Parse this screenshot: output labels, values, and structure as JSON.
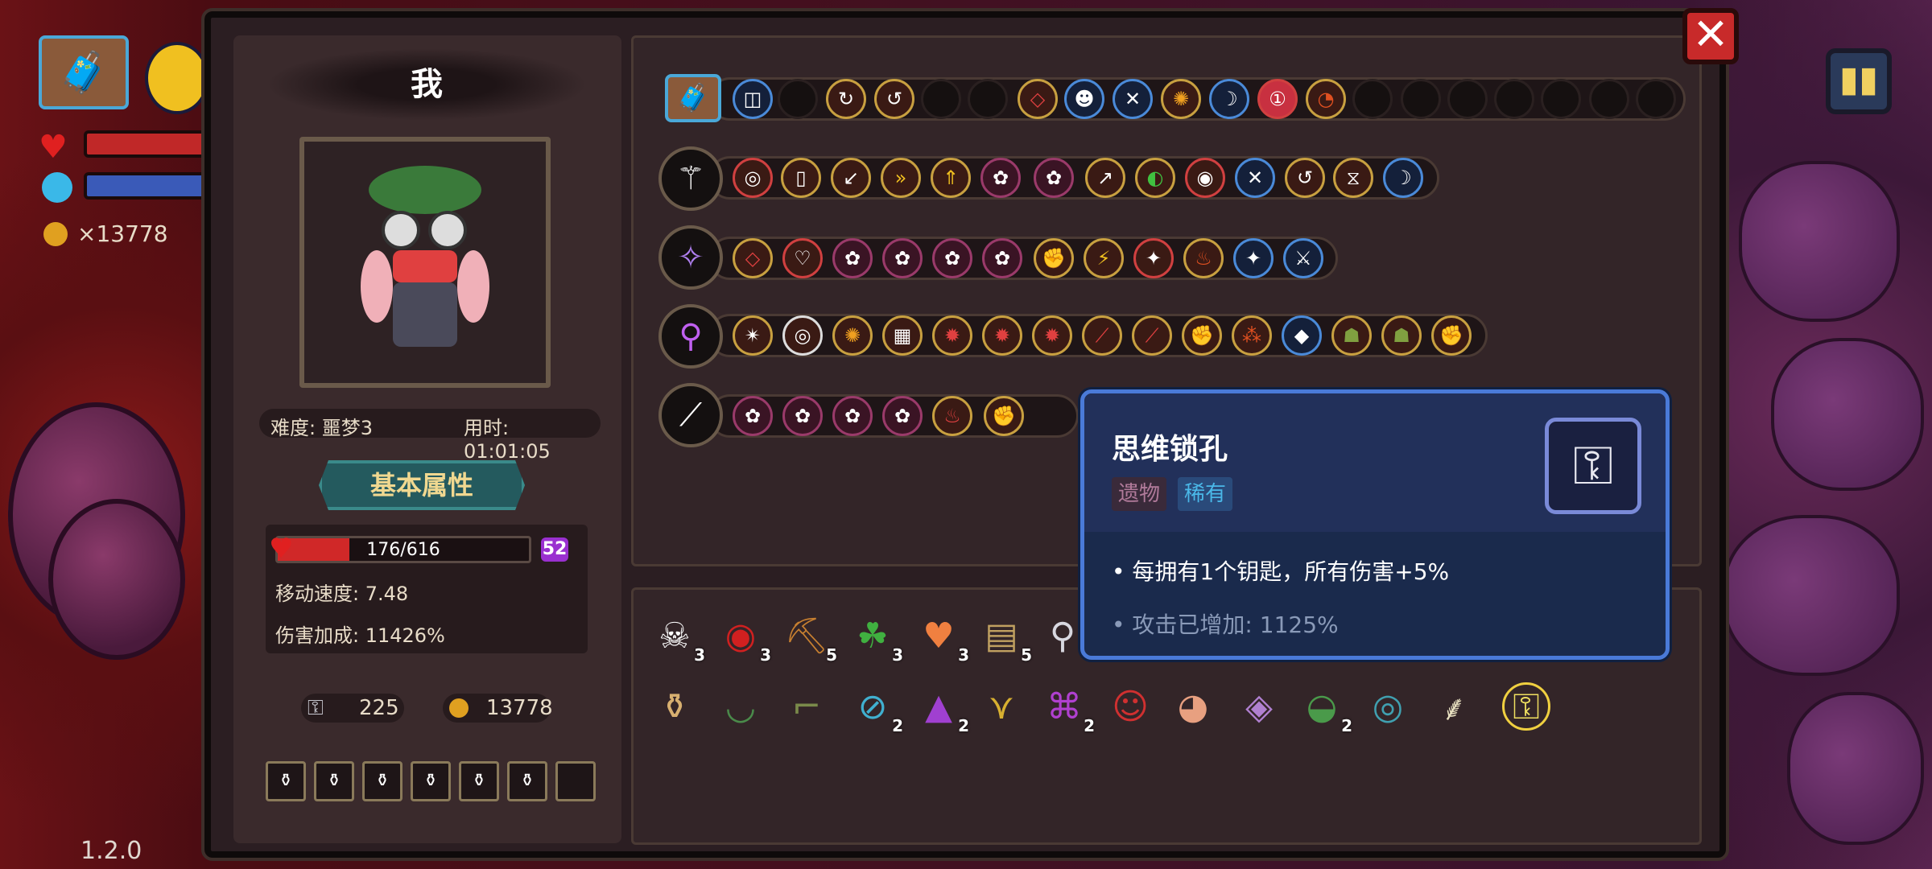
{
  "hud": {
    "coins": "×13778",
    "version": "1.2.0"
  },
  "panel": {
    "player_name": "我",
    "difficulty": "难度: 噩梦3",
    "time": "用时: 01:01:05",
    "attr_tab": "基本属性",
    "hp": "176/616",
    "hp_fraction": 0.286,
    "level_badge": "52",
    "move_speed": "移动速度: 7.48",
    "damage_bonus": "伤害加成: 11426%",
    "keys": "225",
    "gold": "13778"
  },
  "counts": {
    "c1": "3",
    "c2": "3",
    "c3": "5",
    "c4": "3",
    "c5": "3",
    "c6": "5",
    "d4": "2",
    "d5": "2",
    "d7": "2",
    "d10": "2"
  },
  "tooltip": {
    "name": "思维锁孔",
    "tag_type": "遗物",
    "tag_rarity": "稀有",
    "effect": "• 每拥有1个钥匙，所有伤害+5%",
    "current": "• 攻击已增加: 1125%"
  },
  "colors": {
    "hp": "#d02828",
    "mana": "#3a5ab8",
    "rare": "#4ab8e8",
    "tooltip_bg": "#1a2a4c"
  }
}
